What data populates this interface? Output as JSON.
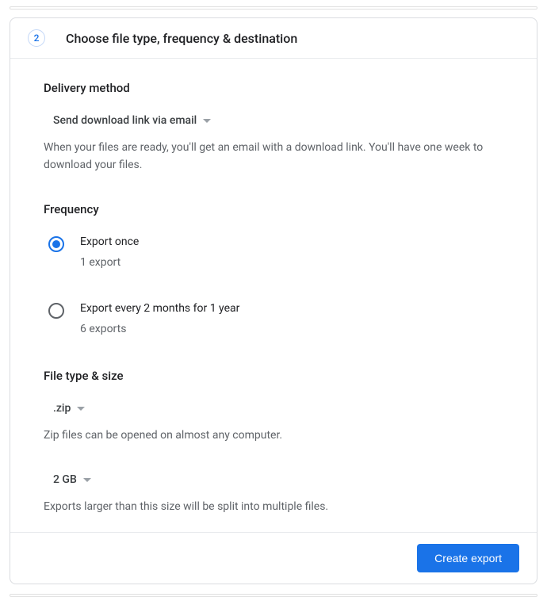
{
  "step": {
    "number": "2",
    "title": "Choose file type, frequency & destination"
  },
  "delivery": {
    "heading": "Delivery method",
    "selected": "Send download link via email",
    "helper": "When your files are ready, you'll get an email with a download link. You'll have one week to download your files."
  },
  "frequency": {
    "heading": "Frequency",
    "options": [
      {
        "label": "Export once",
        "sublabel": "1 export",
        "selected": true
      },
      {
        "label": "Export every 2 months for 1 year",
        "sublabel": "6 exports",
        "selected": false
      }
    ]
  },
  "filetype": {
    "heading": "File type & size",
    "type_selected": ".zip",
    "type_helper": "Zip files can be opened on almost any computer.",
    "size_selected": "2 GB",
    "size_helper": "Exports larger than this size will be split into multiple files."
  },
  "footer": {
    "create_label": "Create export"
  }
}
